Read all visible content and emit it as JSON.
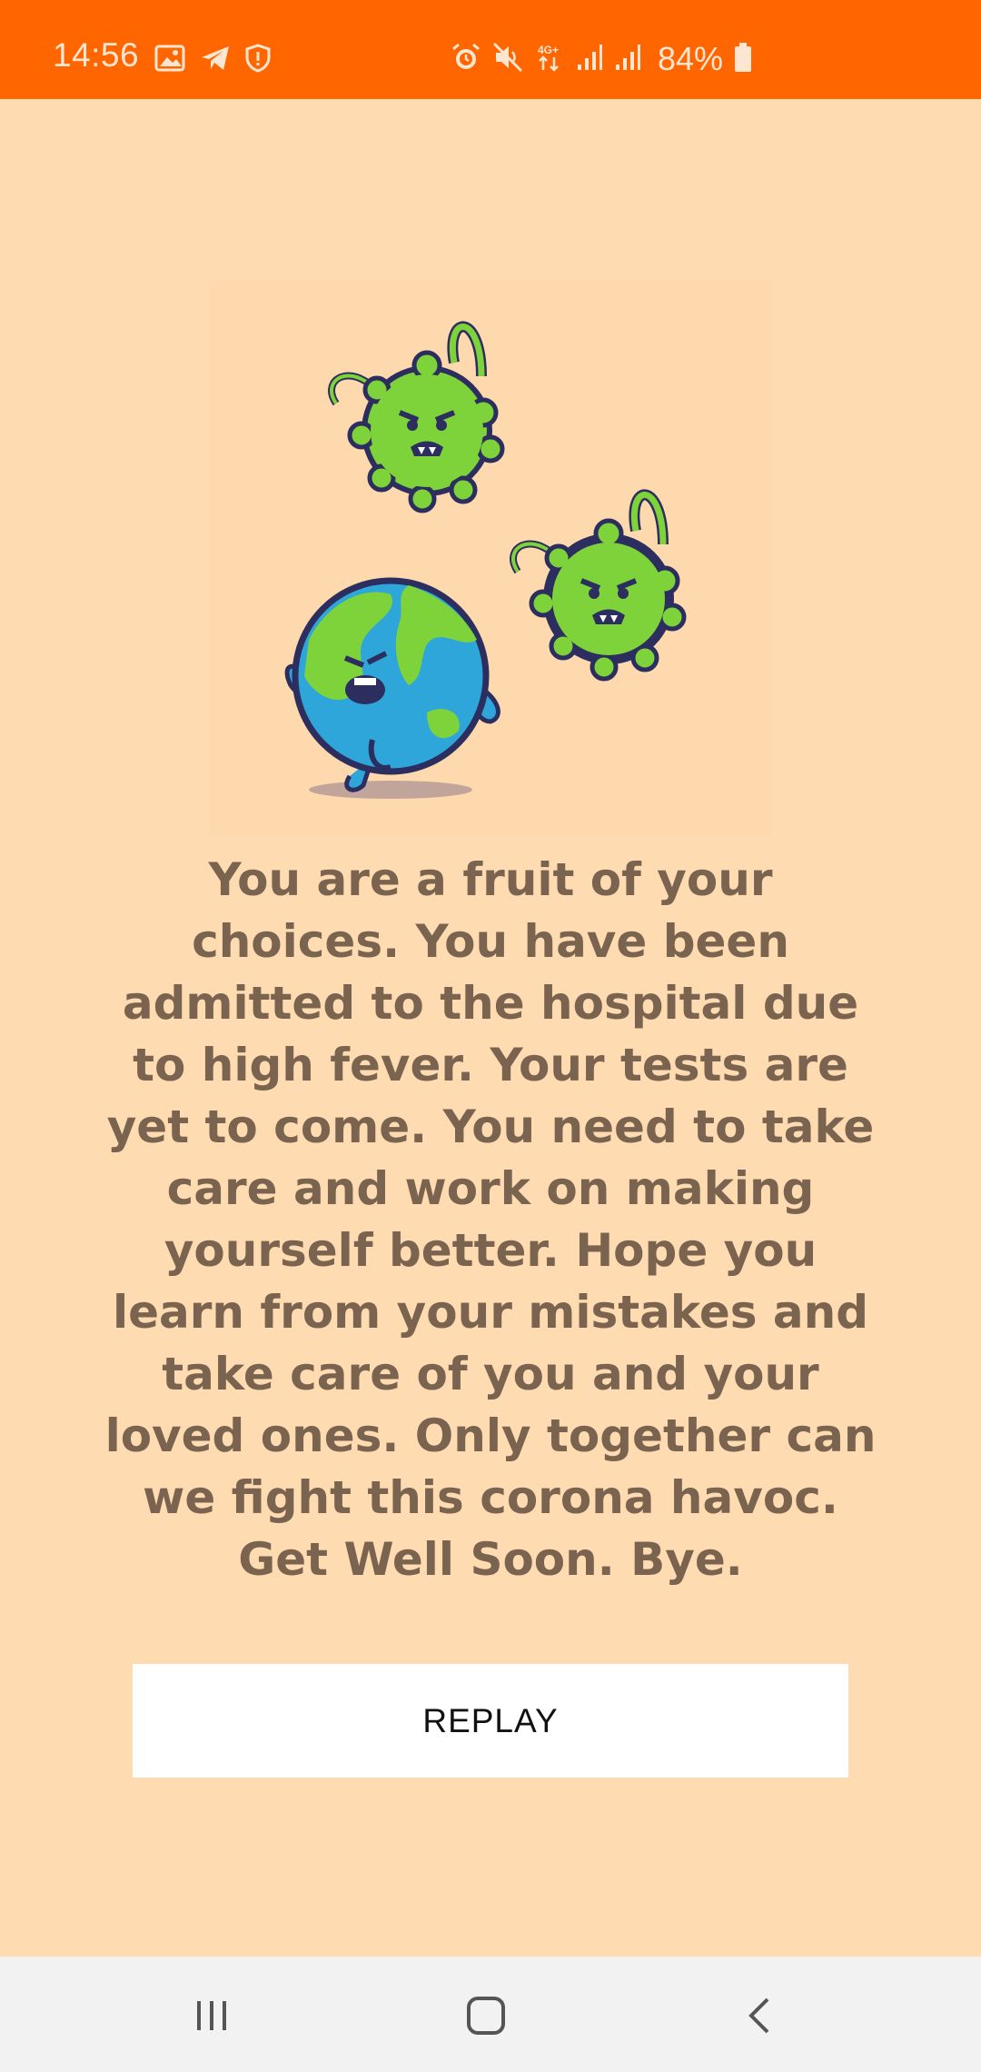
{
  "status_bar": {
    "time": "14:56",
    "battery_percent": "84%",
    "background_color": "#FF6600",
    "left_icons": [
      "gallery-icon",
      "telegram-icon",
      "shield-icon"
    ],
    "right_icons": [
      "alarm-icon",
      "mute-icon",
      "network-4g-icon",
      "signal-icon",
      "signal-icon",
      "battery-icon"
    ],
    "network_label": "4G+"
  },
  "main": {
    "background_color": "#FFDBB1",
    "illustration": "earth-fleeing-virus-illustration",
    "message": "You are a fruit of your choices. You have been admitted to the hospital due to high fever. Your tests are yet to come. You need to take care and work on making yourself better. Hope you learn from your mistakes and take care of you and your loved ones. Only together can we fight this corona havoc. Get Well Soon. Bye.",
    "replay_label": "REPLAY"
  },
  "nav_bar": {
    "buttons": [
      "recent-apps-icon",
      "home-icon",
      "back-icon"
    ]
  }
}
